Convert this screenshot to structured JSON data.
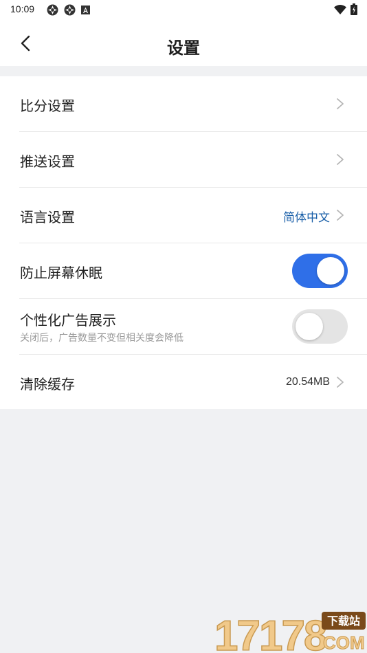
{
  "status_bar": {
    "time": "10:09"
  },
  "header": {
    "title": "设置",
    "back_icon": "chevron-left-icon"
  },
  "settings": {
    "score": {
      "label": "比分设置"
    },
    "push": {
      "label": "推送设置"
    },
    "language": {
      "label": "语言设置",
      "value": "简体中文",
      "value_color": "#1a5fa8"
    },
    "keep_awake": {
      "label": "防止屏幕休眠",
      "enabled": true
    },
    "personalized_ads": {
      "label": "个性化广告展示",
      "sublabel": "关闭后，广告数量不变但相关度会降低",
      "enabled": false
    },
    "cache": {
      "label": "清除缓存",
      "value": "20.54MB"
    }
  },
  "colors": {
    "toggle_on": "#2f6fe8",
    "toggle_off": "#e4e4e4",
    "chevron": "#b5b5b5"
  },
  "watermark": {
    "number": "17178",
    "badge": "下载站",
    "domain": "COM"
  }
}
